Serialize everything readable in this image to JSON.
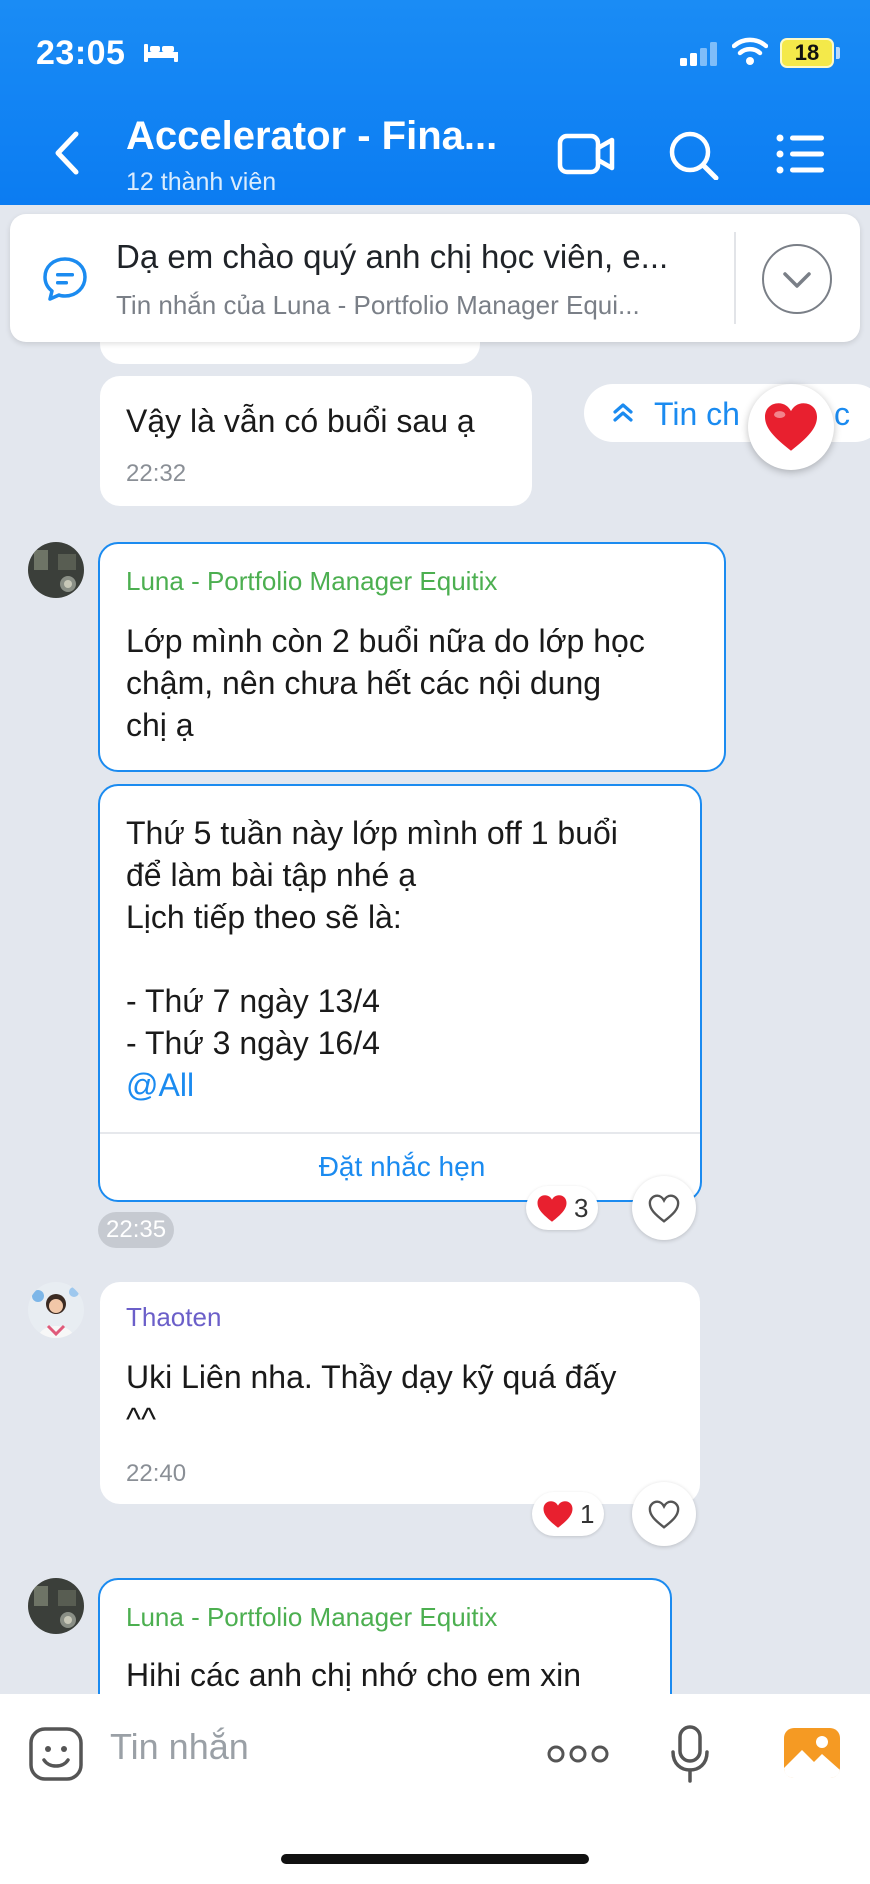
{
  "status_bar": {
    "time": "23:05",
    "battery": "18"
  },
  "header": {
    "title": "Accelerator - Fina...",
    "subtitle": "12 thành viên"
  },
  "pinned": {
    "title": "Dạ em chào quý anh chị học viên, e...",
    "subtitle": "Tin nhắn của Luna - Portfolio Manager Equi..."
  },
  "new_messages_pill": "Tin ch",
  "new_messages_pill_tail": "c",
  "messages": [
    {
      "text": "Vậy là vẫn có buổi sau ạ",
      "time": "22:32"
    },
    {
      "sender": "Luna - Portfolio Manager Equitix",
      "text": "Lớp mình còn 2 buổi nữa do lớp học\nchậm, nên chưa hết các nội dung\nchị ạ"
    },
    {
      "text": "Thứ 5 tuần này lớp mình off 1 buổi\nđể làm bài tập nhé ạ\nLịch tiếp theo sẽ là:\n\n- Thứ 7 ngày 13/4\n- Thứ 3 ngày 16/4",
      "mention": "@All",
      "action": "Đặt nhắc hẹn",
      "time": "22:35",
      "reaction_count": "3"
    },
    {
      "sender": "Thaoten",
      "text": "Uki Liên nha. Thầy dạy kỹ quá đấy\n^^",
      "time": "22:40",
      "reaction_count": "1"
    },
    {
      "sender": "Luna - Portfolio Manager Equitix",
      "text": "Hihi các anh chị nhớ cho em xin"
    }
  ],
  "input": {
    "placeholder": "Tin nhắn"
  },
  "colors": {
    "header_blue": "#1a8cf5",
    "accent_blue": "#1b8bf0",
    "luna_green": "#4caf50",
    "thaoten_purple": "#6b5fc9",
    "heart_red": "#e8202f"
  },
  "icons": [
    "back-icon",
    "video-call-icon",
    "search-icon",
    "menu-list-icon",
    "chat-bubble-icon",
    "chevron-down-icon",
    "heart-icon",
    "sticker-icon",
    "more-icon",
    "microphone-icon",
    "image-icon"
  ]
}
